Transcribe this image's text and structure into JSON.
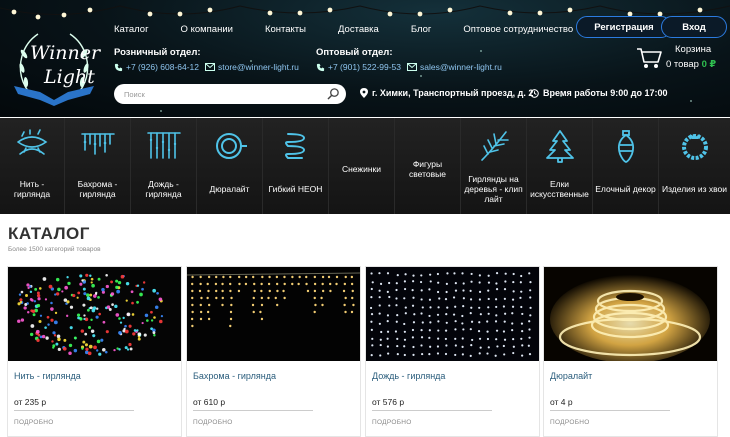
{
  "logo": {
    "line1": "Winner",
    "line2": "Light"
  },
  "nav": [
    "Каталог",
    "О компании",
    "Контакты",
    "Доставка",
    "Блог",
    "Оптовое сотрудничество"
  ],
  "auth": {
    "register": "Регистрация",
    "login": "Вход"
  },
  "retail": {
    "title": "Розничный отдел:",
    "phone": "+7 (926) 608-64-12",
    "email": "store@winner-light.ru"
  },
  "wholesale": {
    "title": "Оптовый отдел:",
    "phone": "+7 (901) 522-99-53",
    "email": "sales@winner-light.ru"
  },
  "cart": {
    "label": "Корзина",
    "count": "0 товар",
    "price": "0 ₽"
  },
  "search": {
    "placeholder": "Поиск"
  },
  "address": "г. Химки, Транспортный проезд, д. 2",
  "hours": "Время работы 9:00 до 17:00",
  "categories": [
    {
      "label": "Нить - гирлянда",
      "icon": "string-light-icon"
    },
    {
      "label": "Бахрома - гирлянда",
      "icon": "icicle-light-icon"
    },
    {
      "label": "Дождь - гирлянда",
      "icon": "curtain-light-icon"
    },
    {
      "label": "Дюралайт",
      "icon": "duralight-icon"
    },
    {
      "label": "Гибкий НЕОН",
      "icon": "neon-icon"
    },
    {
      "label": "Снежинки",
      "icon": ""
    },
    {
      "label": "Фигуры световые",
      "icon": ""
    },
    {
      "label": "Гирлянды на деревья - клип лайт",
      "icon": "tree-branch-icon"
    },
    {
      "label": "Елки искусственные",
      "icon": "christmas-tree-icon"
    },
    {
      "label": "Елочный декор",
      "icon": "ornament-icon"
    },
    {
      "label": "Изделия из хвои",
      "icon": "wreath-icon"
    }
  ],
  "catalog": {
    "title": "КАТАЛОГ",
    "subtitle": "Более 1500 категорий товаров",
    "products": [
      {
        "name": "Нить - гирлянда",
        "price": "от 235 р",
        "more": "ПОДРОБНО"
      },
      {
        "name": "Бахрома - гирлянда",
        "price": "от 610 р",
        "more": "ПОДРОБНО"
      },
      {
        "name": "Дождь - гирлянда",
        "price": "от 576 р",
        "more": "ПОДРОБНО"
      },
      {
        "name": "Дюралайт",
        "price": "от 4 р",
        "more": "ПОДРОБНО"
      }
    ]
  },
  "colors": {
    "accent": "#2b7be0",
    "cart_price": "#2fbf4f",
    "icon": "#4fc3e8",
    "link": "#2a5d7c"
  }
}
